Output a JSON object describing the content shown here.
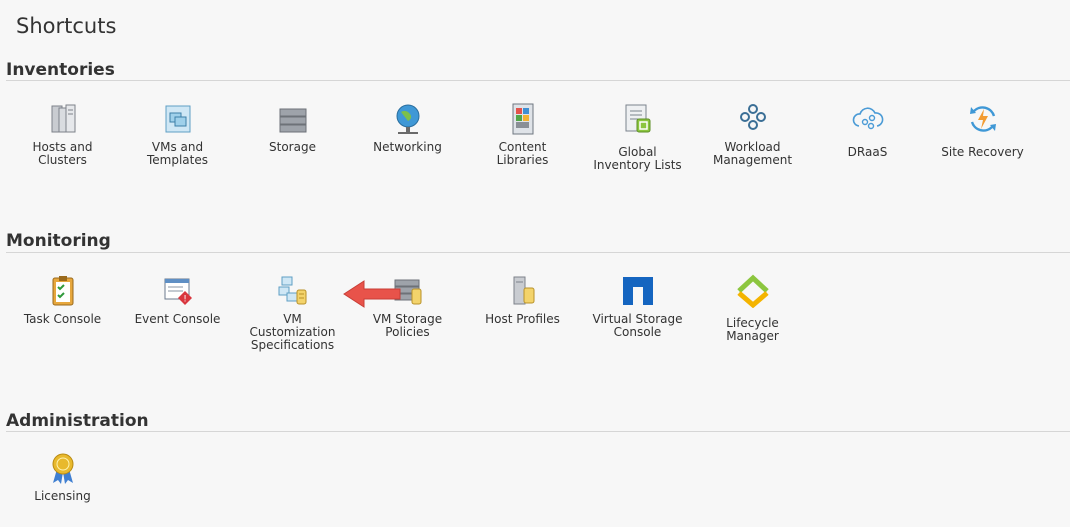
{
  "page_title": "Shortcuts",
  "sections": {
    "inventories": {
      "title": "Inventories",
      "items": [
        {
          "label_1": "Hosts and",
          "label_2": "Clusters",
          "icon": "hosts-clusters-icon"
        },
        {
          "label_1": "VMs and",
          "label_2": "Templates",
          "icon": "vms-templates-icon"
        },
        {
          "label_1": "Storage",
          "label_2": "",
          "icon": "storage-icon"
        },
        {
          "label_1": "Networking",
          "label_2": "",
          "icon": "networking-icon"
        },
        {
          "label_1": "Content",
          "label_2": "Libraries",
          "icon": "content-libraries-icon"
        },
        {
          "label_1": "Global",
          "label_2": "Inventory Lists",
          "icon": "global-inventory-icon"
        },
        {
          "label_1": "Workload",
          "label_2": "Management",
          "icon": "workload-management-icon"
        },
        {
          "label_1": "DRaaS",
          "label_2": "",
          "icon": "draas-icon"
        },
        {
          "label_1": "Site Recovery",
          "label_2": "",
          "icon": "site-recovery-icon"
        }
      ]
    },
    "monitoring": {
      "title": "Monitoring",
      "items": [
        {
          "label_1": "Task Console",
          "label_2": "",
          "label_3": "",
          "icon": "task-console-icon"
        },
        {
          "label_1": "Event Console",
          "label_2": "",
          "label_3": "",
          "icon": "event-console-icon"
        },
        {
          "label_1": "VM",
          "label_2": "Customization",
          "label_3": "Specifications",
          "icon": "vm-customization-icon"
        },
        {
          "label_1": "VM Storage",
          "label_2": "Policies",
          "label_3": "",
          "icon": "vm-storage-policies-icon"
        },
        {
          "label_1": "Host Profiles",
          "label_2": "",
          "label_3": "",
          "icon": "host-profiles-icon"
        },
        {
          "label_1": "Virtual Storage",
          "label_2": "Console",
          "label_3": "",
          "icon": "virtual-storage-console-icon"
        },
        {
          "label_1": "Lifecycle",
          "label_2": "Manager",
          "label_3": "",
          "icon": "lifecycle-manager-icon"
        }
      ]
    },
    "administration": {
      "title": "Administration",
      "items": [
        {
          "label_1": "Licensing",
          "label_2": "",
          "icon": "licensing-icon"
        }
      ]
    }
  },
  "colors": {
    "background": "#f7f7f7",
    "arrow": "#e8534a",
    "vsc_blue": "#1565c0",
    "lifecycle_green": "#8cc63f",
    "lifecycle_yellow": "#f4b400"
  }
}
